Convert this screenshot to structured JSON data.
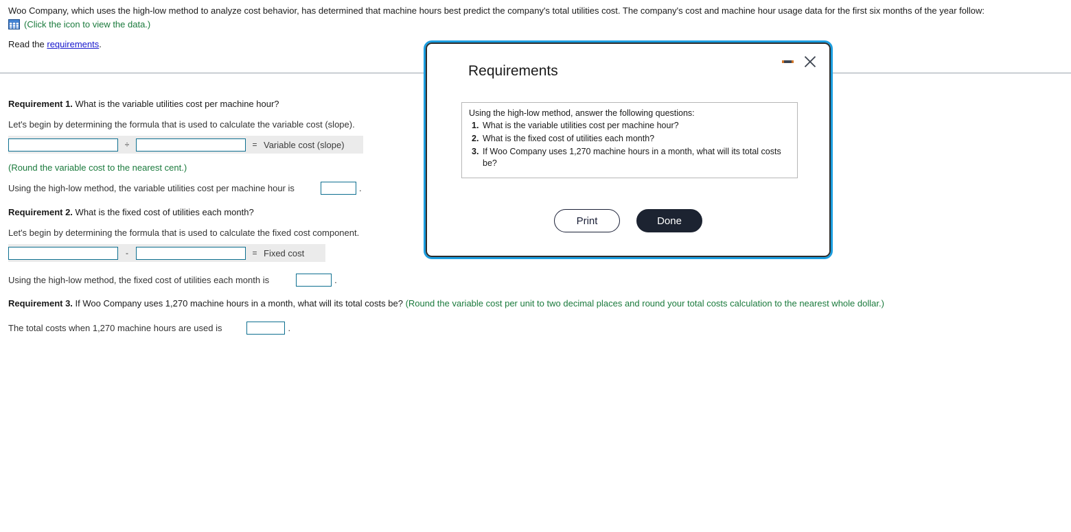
{
  "problem": {
    "statement": "Woo Company, which uses the high-low method to analyze cost behavior, has determined that machine hours best predict the company's total utilities cost. The company's cost and machine hour usage data for the first six months of the year follow:",
    "data_icon_text": "(Click the icon to view the data.)",
    "data_icon_name": "spreadsheet-icon",
    "read_prefix": "Read the ",
    "read_link": "requirements",
    "read_suffix": "."
  },
  "requirement1": {
    "label": "Requirement 1.",
    "question": "What is the variable utilities cost per machine hour?",
    "instruction": "Let's begin by determining the formula that is used to calculate the variable cost (slope).",
    "formula": {
      "operand1": "",
      "operator": "÷",
      "operand2": "",
      "equals": "=",
      "result_label": "Variable cost (slope)"
    },
    "rounding_note": "(Round the variable cost to the nearest cent.)",
    "answer_prefix": "Using the high-low method, the variable utilities cost per machine hour is",
    "answer_value": "",
    "answer_suffix": "."
  },
  "requirement2": {
    "label": "Requirement 2.",
    "question": "What is the fixed cost of utilities each month?",
    "instruction": "Let's begin by determining the formula that is used to calculate the fixed cost component.",
    "formula": {
      "operand1": "",
      "operator": "-",
      "operand2": "",
      "equals": "=",
      "result_label": "Fixed cost"
    },
    "answer_prefix": "Using the high-low method, the fixed cost of utilities each month is",
    "answer_value": "",
    "answer_suffix": "."
  },
  "requirement3": {
    "label": "Requirement 3.",
    "question": "If Woo Company uses 1,270 machine hours in a month, what will its total costs be?",
    "rounding_note": "(Round the variable cost per unit to two decimal places and round your total costs calculation to the nearest whole dollar.)",
    "answer_prefix": "The total costs when 1,270 machine hours are used is",
    "answer_value": "",
    "answer_suffix": "."
  },
  "dialog": {
    "title": "Requirements",
    "minimize_icon": "minimize-icon",
    "close_icon": "close-icon",
    "intro": "Using the high-low method, answer the following questions:",
    "items": [
      {
        "num": "1.",
        "text": "What is the variable utilities cost per machine hour?"
      },
      {
        "num": "2.",
        "text": "What is the fixed cost of utilities each month?"
      },
      {
        "num": "3.",
        "text": "If Woo Company uses 1,270 machine hours in a month, what will its total costs be?"
      }
    ],
    "print_label": "Print",
    "done_label": "Done"
  },
  "colors": {
    "link": "#1414cc",
    "green_note": "#1a7a3c",
    "input_border": "#0c6e8f",
    "dialog_glow": "#1c9ee0",
    "done_button": "#1c2331"
  }
}
